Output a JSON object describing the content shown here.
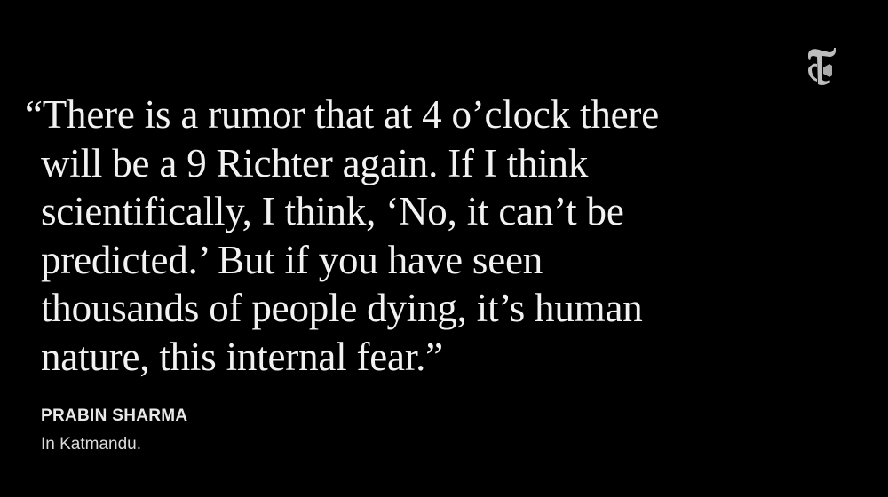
{
  "quote": {
    "lines": [
      "“There is a rumor that at 4 o’clock there",
      "will be a 9 Richter again. If I think",
      "scientifically, I think, ‘No, it can’t be",
      "predicted.’ But if you have seen",
      "thousands of people dying, it’s human",
      "nature, this internal fear.”"
    ]
  },
  "attribution": {
    "name": "PRABIN SHARMA",
    "location": "In Katmandu."
  },
  "logo": {
    "icon": "nyt-t-logo-icon",
    "color": "#bdbdbd"
  },
  "colors": {
    "background": "#000000",
    "text": "#f2f2f2"
  }
}
